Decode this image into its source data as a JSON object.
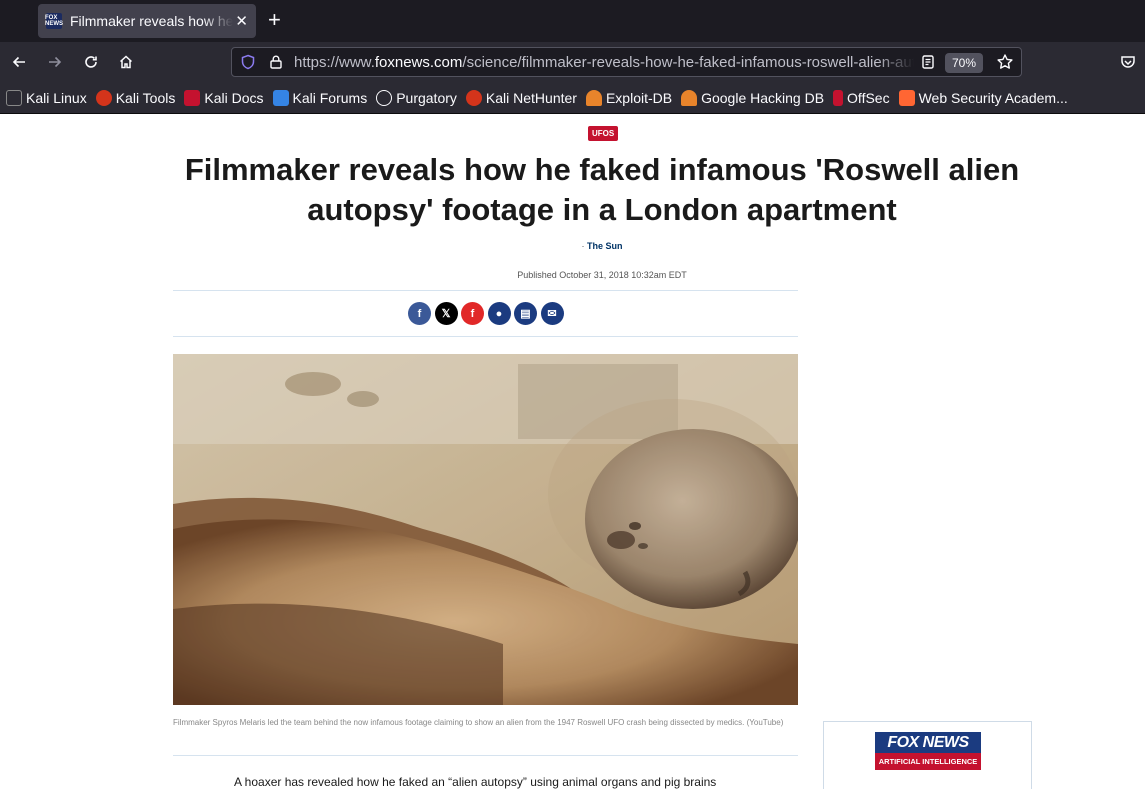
{
  "browser": {
    "tab_title": "Filmmaker reveals how he faked infamous 'Roswell alien autopsy' footage in a London apartment",
    "tab_favicon_text": "FOX NEWS",
    "url_prefix": "https://www.",
    "url_domain": "foxnews.com",
    "url_path": "/science/filmmaker-reveals-how-he-faked-infamous-roswell-alien-autopsy-footage-in-a-london-apartment",
    "zoom": "70%",
    "icons": [
      "back-arrow-icon",
      "forward-arrow-icon",
      "reload-icon",
      "home-icon",
      "shield-icon",
      "lock-icon",
      "reader-view-icon",
      "bookmark-star-icon",
      "pocket-icon",
      "new-tab-plus-icon",
      "close-icon"
    ]
  },
  "bookmarks": [
    {
      "label": "Kali Linux",
      "color": "#1a1a1a"
    },
    {
      "label": "Kali Tools",
      "color": "#d4341b"
    },
    {
      "label": "Kali Docs",
      "color": "#c4122f"
    },
    {
      "label": "Kali Forums",
      "color": "#3584e4"
    },
    {
      "label": "Purgatory",
      "color": "#fbfbfe"
    },
    {
      "label": "Kali NetHunter",
      "color": "#d4341b"
    },
    {
      "label": "Exploit-DB",
      "color": "#e8842b"
    },
    {
      "label": "Google Hacking DB",
      "color": "#e8842b"
    },
    {
      "label": "OffSec",
      "color": "#c4122f"
    },
    {
      "label": "Web Security Academ...",
      "color": "#ff6633"
    }
  ],
  "article": {
    "category": "UFOS",
    "headline": "Filmmaker reveals how he faked infamous 'Roswell alien autopsy' footage in a London apartment",
    "source_prefix": "·",
    "source": "The Sun",
    "published": "Published October 31, 2018 10:32am EDT",
    "share": [
      {
        "name": "facebook",
        "glyph": "f",
        "color": "#3b5998"
      },
      {
        "name": "x",
        "glyph": "𝕏",
        "color": "#000000"
      },
      {
        "name": "flipboard",
        "glyph": "f",
        "color": "#e12828"
      },
      {
        "name": "comments",
        "glyph": "●",
        "color": "#1b3b80"
      },
      {
        "name": "print",
        "glyph": "▤",
        "color": "#1b3b80"
      },
      {
        "name": "email",
        "glyph": "✉",
        "color": "#1b3b80"
      }
    ],
    "caption": "Filmmaker Spyros Melaris led the team behind the now infamous footage claiming to show an alien from the 1947 Roswell UFO crash being dissected by medics. (YouTube)",
    "first_paragraph": "A hoaxer has revealed how he faked an “alien autopsy” using animal organs and pig brains"
  },
  "sidebar_ad": {
    "logo": "FOX NEWS",
    "subtitle": "ARTIFICIAL INTELLIGENCE"
  }
}
